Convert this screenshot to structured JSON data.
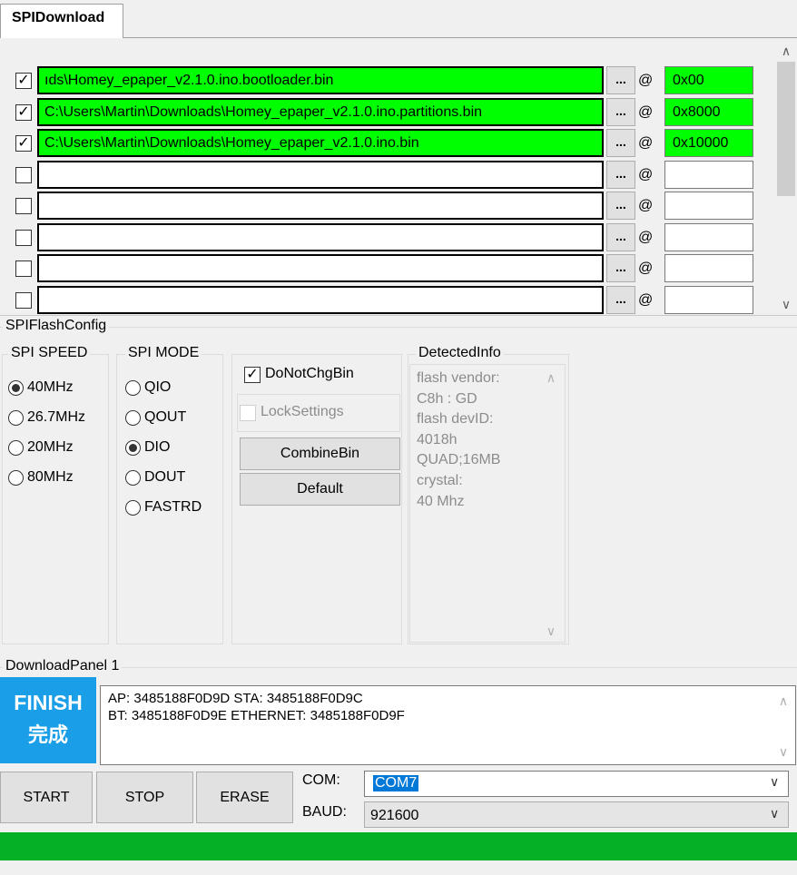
{
  "tab": {
    "label": "SPIDownload"
  },
  "files": [
    {
      "checked": true,
      "path": "ıds\\Homey_epaper_v2.1.0.ino.bootloader.bin",
      "address": "0x00",
      "ok": true
    },
    {
      "checked": true,
      "path": "C:\\Users\\Martin\\Downloads\\Homey_epaper_v2.1.0.ino.partitions.bin",
      "address": "0x8000",
      "ok": true
    },
    {
      "checked": true,
      "path": "C:\\Users\\Martin\\Downloads\\Homey_epaper_v2.1.0.ino.bin",
      "address": "0x10000",
      "ok": true
    },
    {
      "checked": false,
      "path": "",
      "address": "",
      "ok": false
    },
    {
      "checked": false,
      "path": "",
      "address": "",
      "ok": false
    },
    {
      "checked": false,
      "path": "",
      "address": "",
      "ok": false
    },
    {
      "checked": false,
      "path": "",
      "address": "",
      "ok": false
    },
    {
      "checked": false,
      "path": "",
      "address": "",
      "ok": false
    }
  ],
  "browse_label": "...",
  "at_label": "@",
  "spi_flash_config": {
    "title": "SPIFlashConfig",
    "speed": {
      "title": "SPI SPEED",
      "options": [
        "40MHz",
        "26.7MHz",
        "20MHz",
        "80MHz"
      ],
      "selected": "40MHz"
    },
    "mode": {
      "title": "SPI MODE",
      "options": [
        "QIO",
        "QOUT",
        "DIO",
        "DOUT",
        "FASTRD"
      ],
      "selected": "DIO"
    },
    "do_not_chg_bin": {
      "label": "DoNotChgBin",
      "checked": true
    },
    "lock_settings": {
      "label": "LockSettings",
      "checked": false
    },
    "combine_bin_label": "CombineBin",
    "default_label": "Default",
    "detected": {
      "title": "DetectedInfo",
      "lines": [
        "flash vendor:",
        "C8h : GD",
        "flash devID:",
        "4018h",
        "QUAD;16MB",
        "crystal:",
        "40 Mhz"
      ]
    }
  },
  "download_panel": {
    "title": "DownloadPanel 1",
    "status_en": "FINISH",
    "status_cn": "完成",
    "log_lines": [
      "AP:  3485188F0D9D  STA:  3485188F0D9C",
      "BT:  3485188F0D9E  ETHERNET:  3485188F0D9F"
    ],
    "start_label": "START",
    "stop_label": "STOP",
    "erase_label": "ERASE",
    "com_label": "COM:",
    "com_value": "COM7",
    "baud_label": "BAUD:",
    "baud_value": "921600",
    "progress": 1.0
  },
  "colors": {
    "ok_green": "#00ff00",
    "finish_blue": "#1a9ee8",
    "progress_green": "#06b025"
  }
}
